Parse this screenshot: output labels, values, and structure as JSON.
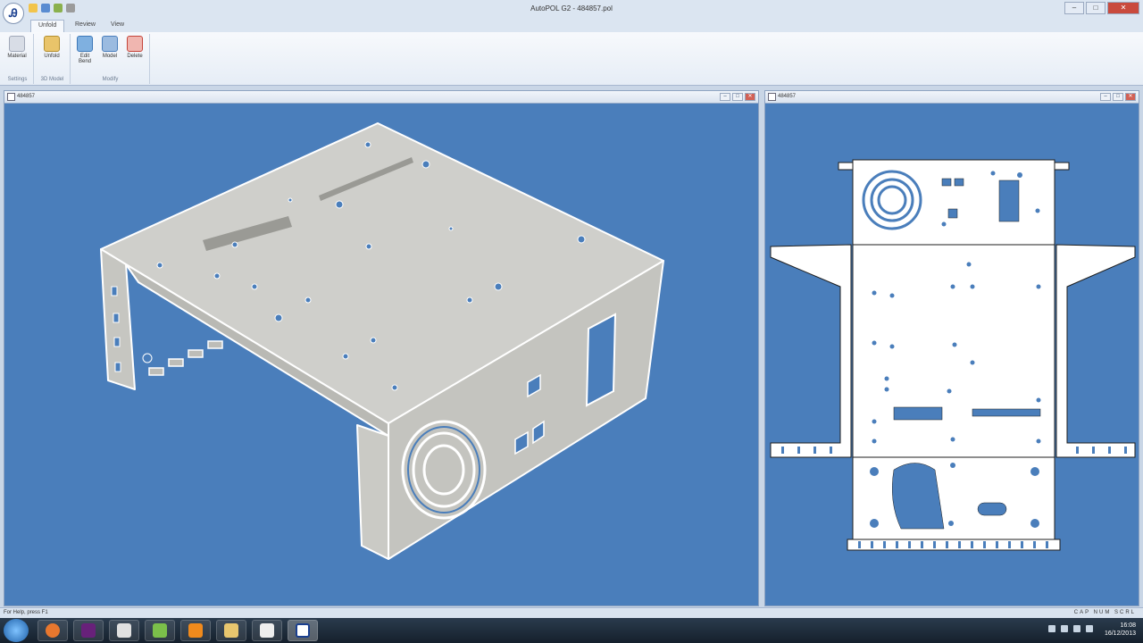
{
  "window": {
    "title": "AutoPOL G2 - 484857.pol",
    "controls": {
      "minimize": "–",
      "maximize": "□",
      "close": "✕"
    }
  },
  "app_button": {
    "glyph": "Ꭿ"
  },
  "ribbon": {
    "tabs": [
      "Unfold",
      "Review",
      "View"
    ],
    "active_tab": "Unfold",
    "groups": [
      {
        "label": "Settings",
        "buttons": [
          {
            "label": "Material",
            "icon": "material-icon"
          }
        ]
      },
      {
        "label": "3D Model",
        "buttons": [
          {
            "label": "Unfold",
            "icon": "unfold-icon"
          }
        ]
      },
      {
        "label": "Modify",
        "buttons": [
          {
            "label": "Edit Bend",
            "icon": "edit-bend-icon"
          },
          {
            "label": "Model",
            "icon": "model-icon"
          },
          {
            "label": "Delete",
            "icon": "delete-icon"
          }
        ]
      }
    ]
  },
  "panes": {
    "left": {
      "title": "484857",
      "view": "3D model"
    },
    "right": {
      "title": "484857",
      "view": "Unfolded flat pattern"
    }
  },
  "status": {
    "left": "For Help, press F1",
    "right": "CAP NUM SCRL"
  },
  "taskbar": {
    "clock_time": "16:08",
    "clock_date": "16/12/2013",
    "apps": [
      "firefox",
      "visual-studio",
      "matlab",
      "notepad",
      "vlc",
      "explorer",
      "remote",
      "autopol"
    ]
  },
  "colors": {
    "viewport": "#4a7ebb",
    "part": "#cdcdc8",
    "ribbon": "#e6edf6"
  }
}
